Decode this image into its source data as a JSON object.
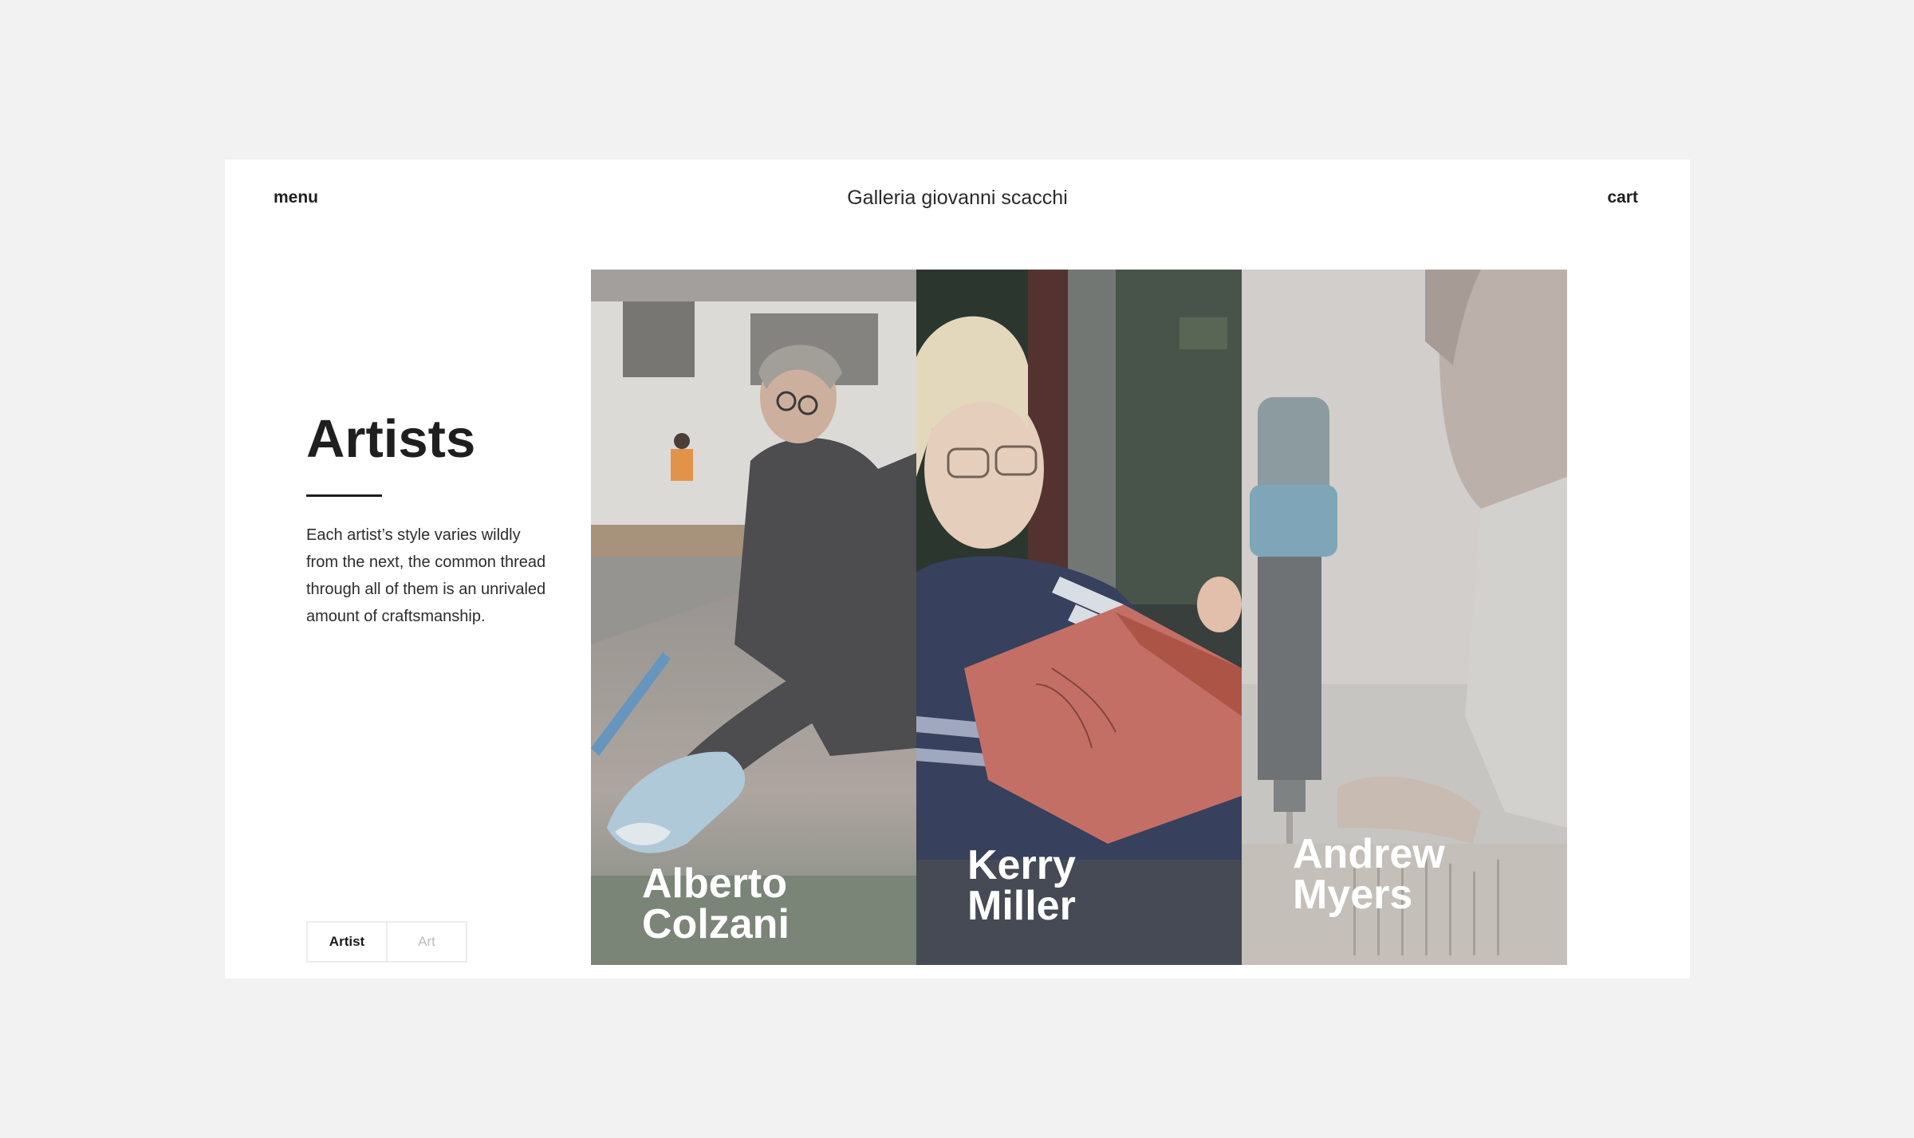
{
  "header": {
    "menu_label": "menu",
    "site_title": "Galleria giovanni scacchi",
    "cart_label": "cart"
  },
  "intro": {
    "heading": "Artists",
    "description": "Each artist’s style varies wildly from the next, the common thread through all of them is an unrivaled amount of craftsmanship."
  },
  "view_toggle": {
    "options": [
      {
        "label": "Artist",
        "active": true
      },
      {
        "label": "Art",
        "active": false
      }
    ]
  },
  "artists": [
    {
      "first": "Alberto",
      "last": "Colzani"
    },
    {
      "first": "Kerry",
      "last": "Miller"
    },
    {
      "first": "Andrew",
      "last": "Myers"
    }
  ]
}
